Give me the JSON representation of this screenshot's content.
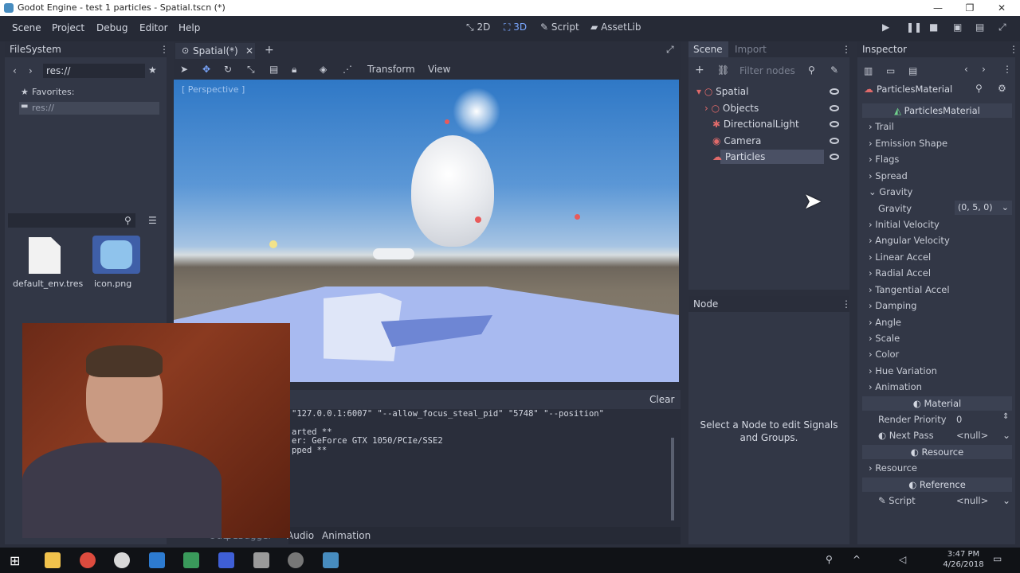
{
  "window": {
    "title": "Godot Engine - test 1 particles - Spatial.tscn (*)"
  },
  "menubar": {
    "items": [
      "Scene",
      "Project",
      "Debug",
      "Editor",
      "Help"
    ]
  },
  "toolbar": {
    "mode_2d": "2D",
    "mode_3d": "3D",
    "script": "Script",
    "assetlib": "AssetLib"
  },
  "filesystem": {
    "header": "FileSystem",
    "path": "res://",
    "favorites_label": "Favorites:",
    "root_label": "res://",
    "files": [
      {
        "name": "default_env.tres"
      },
      {
        "name": "icon.png"
      }
    ]
  },
  "viewport": {
    "tab": "Spatial(*)",
    "perspective": "[ Perspective ]",
    "menu_transform": "Transform",
    "menu_view": "View"
  },
  "scene": {
    "tab_scene": "Scene",
    "tab_import": "Import",
    "filter_placeholder": "Filter nodes",
    "nodes": [
      "Spatial",
      "Objects",
      "DirectionalLight",
      "Camera",
      "Particles"
    ]
  },
  "node_panel": {
    "header": "Node",
    "message": "Select a Node to edit Signals and Groups."
  },
  "output": {
    "clear": "Clear",
    "lines": [
      "\"127.0.0.1:6007\" \"--allow_focus_steal_pid\" \"5748\" \"--position\"",
      "",
      "arted **",
      "er: GeForce GTX 1050/PCIe/SSE2",
      "pped **"
    ],
    "tabs": [
      "Output",
      "Debugger",
      "Audio",
      "Animation"
    ]
  },
  "inspector": {
    "header": "Inspector",
    "resource_name": "ParticlesMaterial",
    "section_title": "ParticlesMaterial",
    "groups": [
      "Trail",
      "Emission Shape",
      "Flags",
      "Spread",
      "Gravity"
    ],
    "gravity_label": "Gravity",
    "gravity_value": "(0, 5, 0)",
    "groups2": [
      "Initial Velocity",
      "Angular Velocity",
      "Linear Accel",
      "Radial Accel",
      "Tangential Accel",
      "Damping",
      "Angle",
      "Scale",
      "Color",
      "Hue Variation",
      "Animation"
    ],
    "material_section": "Material",
    "render_priority_label": "Render Priority",
    "render_priority_value": "0",
    "next_pass_label": "Next Pass",
    "next_pass_value": "<null>",
    "resource_section": "Resource",
    "resource_label": "Resource",
    "reference_section": "Reference",
    "script_label": "Script",
    "script_value": "<null>"
  },
  "taskbar": {
    "time": "3:47 PM",
    "date": "4/26/2018"
  }
}
